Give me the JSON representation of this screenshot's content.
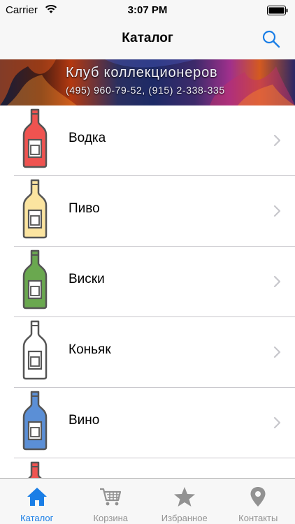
{
  "status_bar": {
    "carrier": "Carrier",
    "time": "3:07 PM"
  },
  "nav": {
    "title": "Каталог",
    "search_icon": "search-icon"
  },
  "banner": {
    "title": "Клуб коллекционеров",
    "phones": "(495) 960-79-52, (915) 2-338-335"
  },
  "catalog": {
    "items": [
      {
        "label": "Водка",
        "color": "#ef5350"
      },
      {
        "label": "Пиво",
        "color": "#fbe4a0"
      },
      {
        "label": "Виски",
        "color": "#6aa84f"
      },
      {
        "label": "Коньяк",
        "color": "#ffffff"
      },
      {
        "label": "Вино",
        "color": "#5b8fd6"
      },
      {
        "label": "",
        "color": "#ef5350"
      }
    ]
  },
  "tab_bar": {
    "tabs": [
      {
        "label": "Каталог",
        "icon": "home-icon",
        "active": true
      },
      {
        "label": "Корзина",
        "icon": "cart-icon",
        "active": false
      },
      {
        "label": "Избранное",
        "icon": "star-icon",
        "active": false
      },
      {
        "label": "Контакты",
        "icon": "location-pin-icon",
        "active": false
      }
    ]
  },
  "colors": {
    "accent": "#1a7ee6",
    "inactive": "#929292",
    "bar_background": "#f7f7f7",
    "separator": "#c8c7cc"
  }
}
